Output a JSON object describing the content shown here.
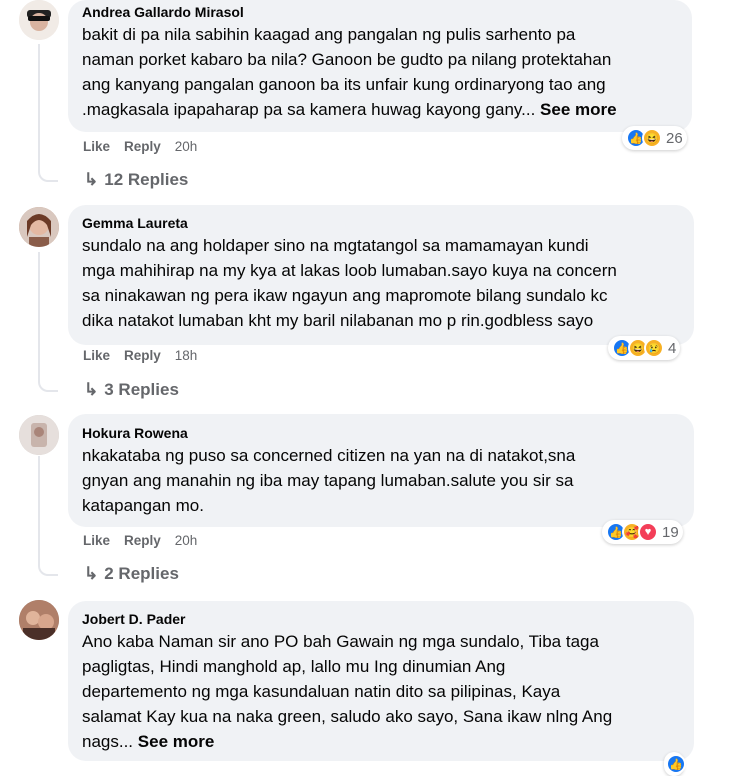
{
  "comments": [
    {
      "author": "Andrea Gallardo Mirasol",
      "lines": [
        "bakit di pa nila sabihin kaagad ang pangalan ng pulis sarhento pa",
        "naman porket kabaro ba nila? Ganoon be gudto pa nilang protektahan",
        "ang kanyang pangalan ganoon ba its unfair kung ordinaryong tao ang",
        ".magkasala ipapaharap pa sa kamera huwag kayong gany..."
      ],
      "see_more": "See more",
      "like": "Like",
      "reply": "Reply",
      "time": "20h",
      "reaction_count": "26",
      "replies": "12 Replies"
    },
    {
      "author": "Gemma Laureta",
      "lines": [
        "sundalo na ang holdaper sino na mgtatangol sa mamamayan kundi",
        "mga mahihirap na my kya at lakas loob lumaban.sayo kuya na concern",
        "sa ninakawan ng pera ikaw ngayun ang mapromote bilang sundalo kc",
        "dika natakot lumaban kht my baril nilabanan mo p rin.godbless sayo"
      ],
      "like": "Like",
      "reply": "Reply",
      "time": "18h",
      "reaction_count": "4",
      "replies": "3 Replies"
    },
    {
      "author": "Hokura Rowena",
      "lines": [
        "nkakataba ng puso sa concerned citizen na yan na di natakot,sna",
        "gnyan ang manahin ng iba may tapang lumaban.salute you sir sa",
        "katapangan mo."
      ],
      "like": "Like",
      "reply": "Reply",
      "time": "20h",
      "reaction_count": "19",
      "replies": "2 Replies"
    },
    {
      "author": "Jobert D. Pader",
      "lines": [
        "Ano kaba Naman sir ano PO bah Gawain ng mga sundalo, Tiba taga",
        "pagligtas, Hindi manghold ap, lallo mu Ing dinumian Ang",
        "departemento ng mga kasundaluan natin dito sa pilipinas, Kaya",
        "salamat Kay kua na naka green, saludo ako sayo, Sana ikaw nlng Ang",
        "nags..."
      ],
      "see_more": "See more"
    }
  ],
  "colors": {
    "like_blue": "#1877f2",
    "bubble": "#f0f2f5",
    "muted": "#65676b"
  }
}
